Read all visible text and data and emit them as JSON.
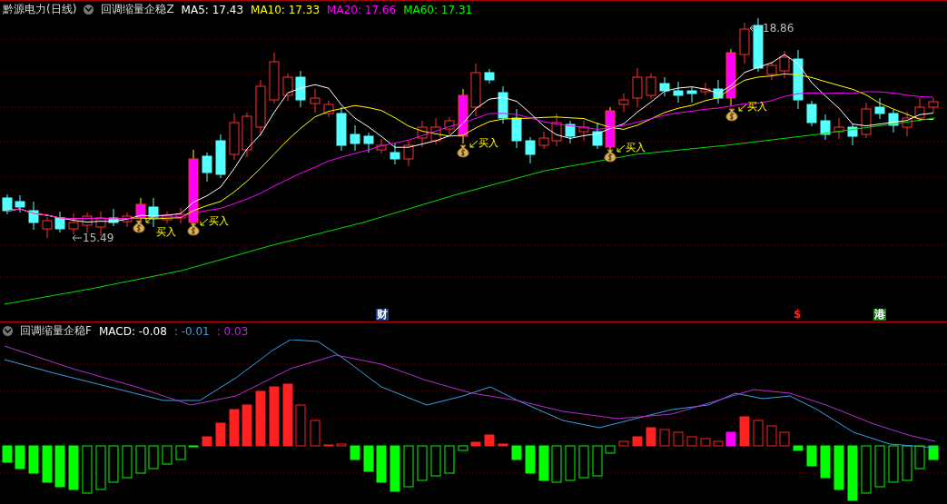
{
  "header": {
    "stock": "黔源电力(日线)",
    "indicator": "回调缩量企稳Z",
    "values": [
      {
        "label": "MA5: 17.43",
        "color": "#ffffff"
      },
      {
        "label": "MA10: 17.33",
        "color": "#ffff00"
      },
      {
        "label": "MA20: 17.66",
        "color": "#ff00ff"
      },
      {
        "label": "MA60: 17.31",
        "color": "#00ff00"
      }
    ]
  },
  "main_chart": {
    "high_label": "18.86",
    "low_label": "15.49",
    "signals": [
      "买入",
      "买入",
      "买入",
      "买入",
      "买入"
    ]
  },
  "markers": [
    {
      "text": "财",
      "kind": "badge",
      "color": "#163d7a"
    },
    {
      "text": "$",
      "kind": "plain",
      "color": "#ff2020"
    },
    {
      "text": "港",
      "kind": "badge",
      "color": "#13801a"
    }
  ],
  "sub_header": {
    "indicator": "回调缩量企稳F",
    "values": [
      {
        "label": "MACD: -0.08",
        "color": "#ffffff"
      },
      {
        "label": ": -0.01",
        "color": "#3aa0e0"
      },
      {
        "label": ": 0.03",
        "color": "#b030d0"
      }
    ]
  }
}
